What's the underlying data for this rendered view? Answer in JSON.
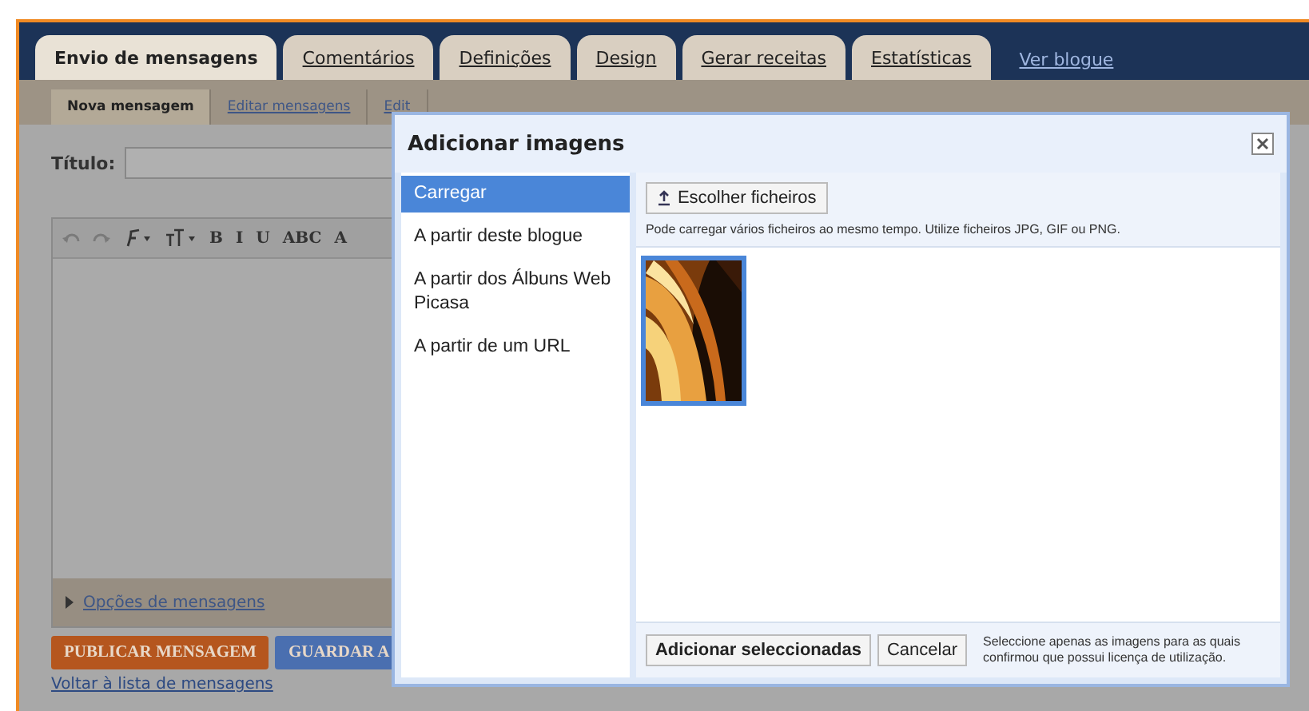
{
  "tabs": [
    {
      "label": "Envio de mensagens",
      "selected": true
    },
    {
      "label": "Comentários",
      "selected": false
    },
    {
      "label": "Definições",
      "selected": false
    },
    {
      "label": "Design",
      "selected": false
    },
    {
      "label": "Gerar receitas",
      "selected": false
    },
    {
      "label": "Estatísticas",
      "selected": false
    }
  ],
  "view_blog_link": "Ver blogue",
  "subtabs": [
    {
      "label": "Nova mensagem",
      "selected": true
    },
    {
      "label": "Editar mensagens",
      "selected": false
    },
    {
      "label": "Edit",
      "selected": false
    }
  ],
  "title_label": "Título:",
  "toolbar": [
    "B",
    "I",
    "U",
    "ABC",
    "A"
  ],
  "post_options": "Opções de mensagens",
  "buttons": [
    {
      "label": "PUBLICAR MENSAGEM",
      "kind": "publish"
    },
    {
      "label": "GUARDAR A",
      "kind": "save"
    }
  ],
  "back_link": "Voltar à lista de mensagens",
  "dialog": {
    "title": "Adicionar imagens",
    "sources": [
      {
        "label": "Carregar",
        "selected": true
      },
      {
        "label": "A partir deste blogue",
        "selected": false
      },
      {
        "label": "A partir dos Álbuns Web Picasa",
        "selected": false
      },
      {
        "label": "A partir de um URL",
        "selected": false
      }
    ],
    "choose_button": "Escolher ficheiros",
    "hint": "Pode carregar vários ficheiros ao mesmo tempo. Utilize ficheiros JPG, GIF ou PNG.",
    "thumbnails": [
      {
        "kind": "picture",
        "selected": true
      }
    ],
    "add_button": "Adicionar seleccionadas",
    "cancel_button": "Cancelar",
    "note": "Seleccione apenas as imagens para as quais confirmou que possui licença de utilização."
  }
}
